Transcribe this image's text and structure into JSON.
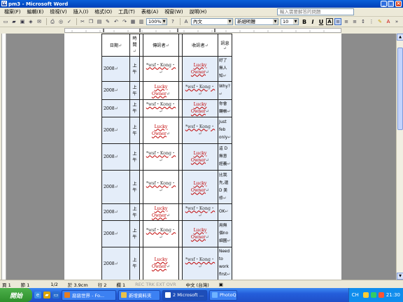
{
  "window": {
    "title": "pm3 - Microsoft Word",
    "icon_label": "W",
    "controls": {
      "minimize": "_",
      "maximize": "□",
      "close": "×"
    }
  },
  "menu": {
    "items": [
      "檔案(F)",
      "編輯(E)",
      "檢視(V)",
      "插入(I)",
      "格式(O)",
      "工具(T)",
      "表格(A)",
      "視窗(W)",
      "說明(H)"
    ],
    "help_placeholder": "輸入需要解答的問題"
  },
  "toolbar": {
    "zoom": "100%",
    "style": "內文",
    "font": "新細明體",
    "size": "10",
    "bold": "B",
    "italic": "I",
    "underline": "U",
    "char_border": "A"
  },
  "table": {
    "headers": {
      "date": "日期",
      "time": "時間",
      "sender": "傳訊者",
      "receiver": "收訊者",
      "message": "訊息"
    },
    "rows": [
      {
        "date": "2008",
        "time": [
          "上",
          "午"
        ],
        "sender": "*wsf・Kong・",
        "receiver": "Lucky Owner",
        "message": [
          "好了",
          "無人",
          "知"
        ],
        "sender_lucky": false,
        "receiver_lucky": true
      },
      {
        "date": "2008",
        "time": [
          "上",
          "午"
        ],
        "sender": "Lucky Owner",
        "receiver": "*wsf・Kong・",
        "message": [
          "Why?"
        ],
        "sender_lucky": true,
        "receiver_lucky": false
      },
      {
        "date": "2008",
        "time": [
          "上",
          "午"
        ],
        "sender": "*wsf・Kong・",
        "receiver": "Lucky Owner",
        "message": [
          "你會",
          "轉帳"
        ],
        "sender_lucky": false,
        "receiver_lucky": true
      },
      {
        "date": "2008",
        "time": [
          "上",
          "午"
        ],
        "sender": "Lucky Owner",
        "receiver": "*wsf・Kong・",
        "message": [
          "Just",
          "feb",
          "only"
        ],
        "sender_lucky": true,
        "receiver_lucky": false
      },
      {
        "date": "2008",
        "time": [
          "上",
          "午"
        ],
        "sender": "*wsf・Kong・",
        "receiver": "Lucky Owner",
        "message": [
          "這 D",
          "無意",
          "經義"
        ],
        "sender_lucky": false,
        "receiver_lucky": true
      },
      {
        "date": "2008",
        "time": [
          "上",
          "午"
        ],
        "sender": "*wsf・Kong・",
        "receiver": "Lucky Owner",
        "message": [
          "比我",
          "先,還",
          "D 美",
          "修"
        ],
        "sender_lucky": false,
        "receiver_lucky": true
      },
      {
        "date": "2008",
        "time": [
          "上",
          "午"
        ],
        "sender": "Lucky Owner",
        "receiver": "*wsf・Kong・",
        "message": [
          "OK"
        ],
        "sender_lucky": true,
        "receiver_lucky": false
      },
      {
        "date": "2008",
        "time": [
          "上",
          "午"
        ],
        "sender": "*wsf・Kong・",
        "receiver": "Lucky Owner",
        "message": [
          "用無",
          "個no",
          "細圖"
        ],
        "sender_lucky": false,
        "receiver_lucky": true
      },
      {
        "date": "2008",
        "time": [
          "上",
          "午"
        ],
        "sender": "Lucky Owner",
        "receiver": "*wsf・Kong・",
        "message": [
          "Need",
          "to",
          "work",
          "first"
        ],
        "sender_lucky": true,
        "receiver_lucky": false
      }
    ]
  },
  "status": {
    "page": "頁 1",
    "section": "節 1",
    "page_of": "1/2",
    "at": "於 3.9cm",
    "line": "行 2",
    "col": "欄 1",
    "modes": "REC  TRK  EXT  OVR",
    "lang": "中文 (台灣)"
  },
  "taskbar": {
    "start": "開始",
    "tasks": [
      "惡惡世界 - Fo...",
      "新增資料夾",
      "2 Microsoft ...",
      "PhotoQ"
    ],
    "active_index": 2,
    "tray_lang": "CH",
    "clock": "21:30"
  }
}
